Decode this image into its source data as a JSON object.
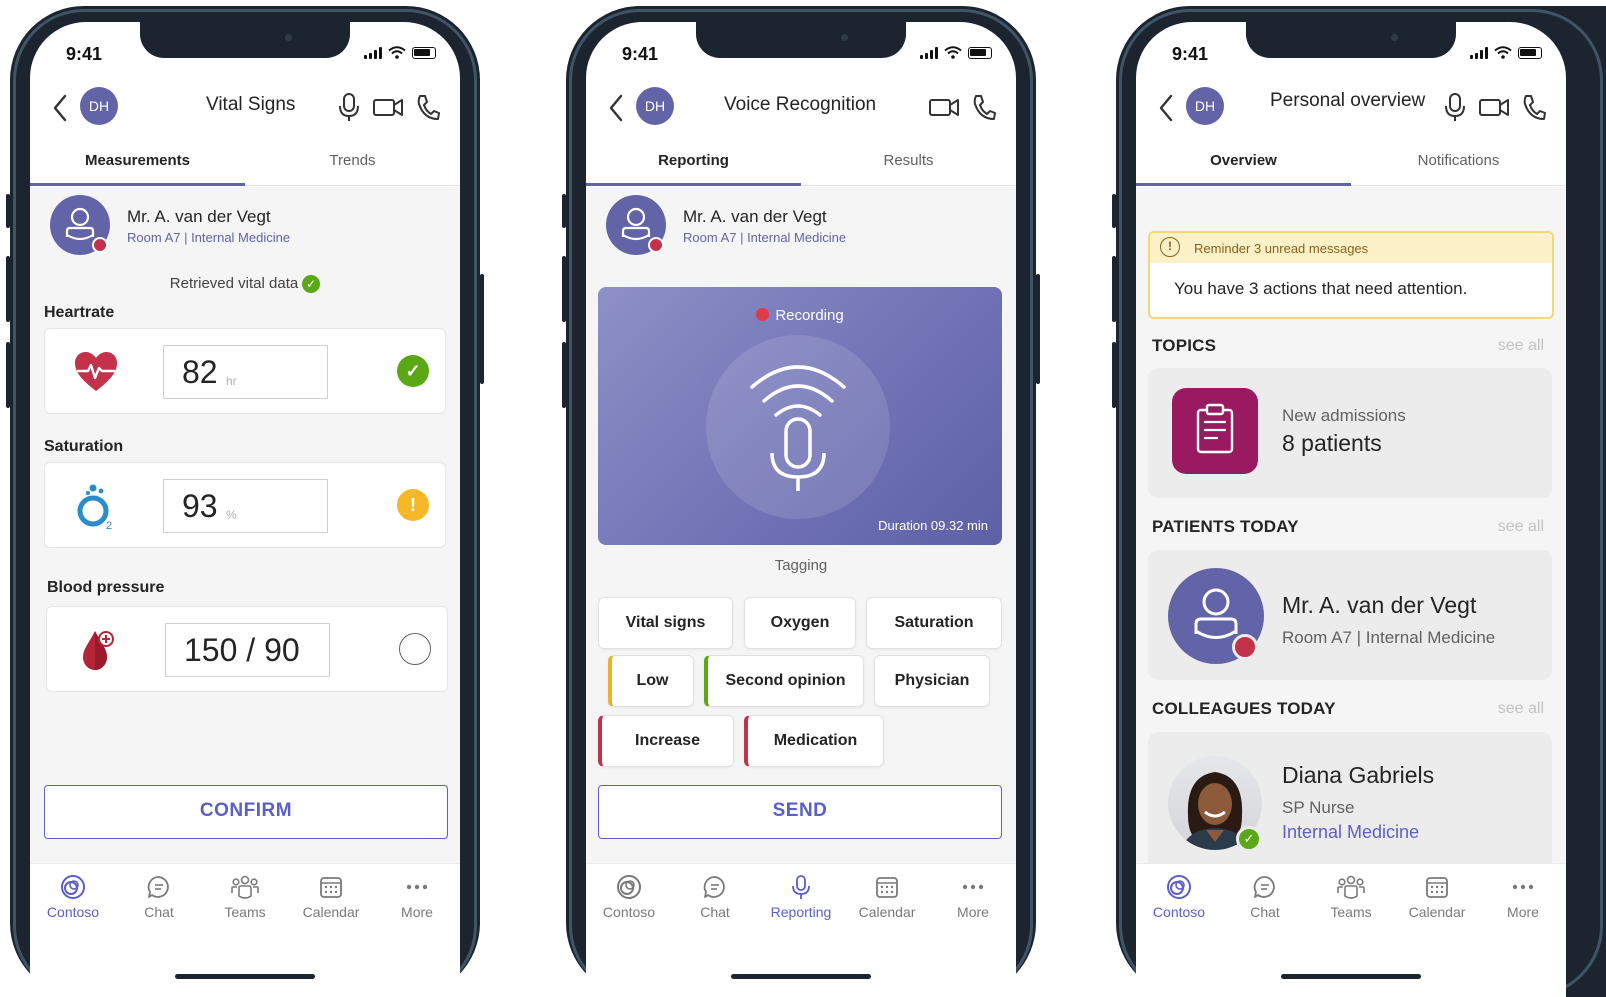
{
  "status": {
    "time": "9:41"
  },
  "phones": [
    {
      "avatar": "DH",
      "title": "Vital Signs",
      "tabs": [
        "Measurements",
        "Trends"
      ],
      "patient": {
        "name": "Mr. A. van der Vegt",
        "room": "Room A7 | Internal Medicine"
      },
      "retrieved": "Retrieved vital data",
      "measurements": [
        {
          "label": "Heartrate",
          "value": "82",
          "unit": "hr",
          "status": "ok",
          "icon": "heart-pulse-icon"
        },
        {
          "label": "Saturation",
          "value": "93",
          "unit": "%",
          "status": "warning",
          "icon": "oxygen-icon"
        },
        {
          "label": "Blood pressure",
          "value": "150 / 90",
          "unit": "",
          "status": "empty",
          "icon": "blood-drop-icon"
        }
      ],
      "action": "CONFIRM",
      "nav": [
        "Contoso",
        "Chat",
        "Teams",
        "Calendar",
        "More"
      ],
      "nav_active": "Contoso"
    },
    {
      "avatar": "DH",
      "title": "Voice Recognition",
      "tabs": [
        "Reporting",
        "Results"
      ],
      "patient": {
        "name": "Mr. A. van der Vegt",
        "room": "Room A7 | Internal Medicine"
      },
      "recording": {
        "label": "Recording",
        "duration": "Duration 09.32 min"
      },
      "tagging": "Tagging",
      "tags": [
        "Vital signs",
        "Oxygen",
        "Saturation",
        "Low",
        "Second opinion",
        "Physician",
        "Increase",
        "Medication"
      ],
      "action": "SEND",
      "nav": [
        "Contoso",
        "Chat",
        "Reporting",
        "Calendar",
        "More"
      ],
      "nav_active": "Reporting"
    },
    {
      "avatar": "DH",
      "title": "Personal overview",
      "tabs": [
        "Overview",
        "Notifications"
      ],
      "reminder": {
        "title": "Reminder 3 unread messages",
        "text": "You have 3 actions that need attention."
      },
      "see_all": "see all",
      "sections": {
        "topics": {
          "heading": "TOPICS",
          "sub": "New admissions",
          "main": "8 patients"
        },
        "patients": {
          "heading": "PATIENTS TODAY",
          "name": "Mr. A. van der Vegt",
          "room": "Room A7 | Internal Medicine"
        },
        "colleagues": {
          "heading": "COLLEAGUES TODAY",
          "name": "Diana Gabriels",
          "role": "SP Nurse",
          "dept": "Internal Medicine"
        }
      },
      "nav": [
        "Contoso",
        "Chat",
        "Teams",
        "Calendar",
        "More"
      ],
      "nav_active": "Contoso"
    }
  ],
  "colors": {
    "accent": "#6264a7",
    "link": "#5b5fc7",
    "ok": "#5ba816",
    "warning": "#f8b727",
    "alert": "#c4314b",
    "topic": "#9a1a62"
  }
}
